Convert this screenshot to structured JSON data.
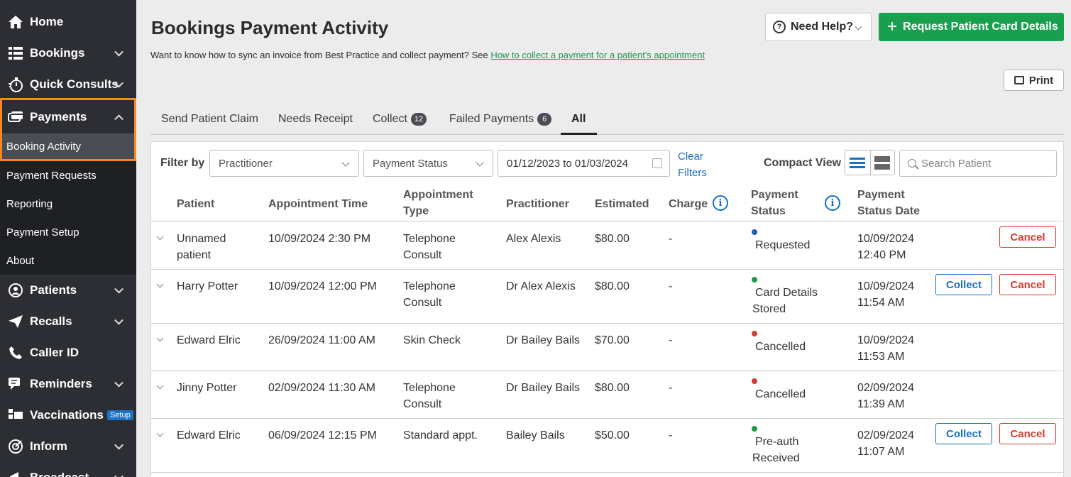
{
  "sidebar": {
    "items_top": [
      {
        "label": "Home",
        "icon": "home-icon"
      },
      {
        "label": "Bookings",
        "icon": "bookings-icon"
      },
      {
        "label": "Quick Consults",
        "icon": "stopwatch-icon"
      }
    ],
    "payments": {
      "label": "Payments",
      "icon": "payments-icon",
      "active_sub": "Booking Activity"
    },
    "sub_items": [
      "Payment Requests",
      "Reporting",
      "Payment Setup",
      "About"
    ],
    "items_bottom": [
      {
        "label": "Patients",
        "icon": "patients-icon"
      },
      {
        "label": "Recalls",
        "icon": "send-icon"
      },
      {
        "label": "Caller ID",
        "icon": "phone-icon"
      },
      {
        "label": "Reminders",
        "icon": "chat-icon"
      },
      {
        "label": "Vaccinations",
        "icon": "vaccination-icon",
        "badge": "Setup"
      },
      {
        "label": "Inform",
        "icon": "inform-icon"
      },
      {
        "label": "Broadcast",
        "icon": "broadcast-icon"
      }
    ]
  },
  "header": {
    "title": "Bookings Payment Activity",
    "intro_text": "Want to know how to sync an invoice from Best Practice and collect payment? See ",
    "intro_link": "How to collect a payment for a patient's appointment",
    "help_label": "Need Help?",
    "request_label": "Request Patient Card Details",
    "print_label": "Print"
  },
  "tabs": [
    {
      "label": "Send Patient Claim",
      "count": null
    },
    {
      "label": "Needs Receipt",
      "count": null
    },
    {
      "label": "Collect",
      "count": "12"
    },
    {
      "label": "Failed Payments",
      "count": "6"
    },
    {
      "label": "All",
      "count": null
    }
  ],
  "filters": {
    "label": "Filter by",
    "practitioner": "Practitioner",
    "payment_status": "Payment Status",
    "date_range": "01/12/2023 to 01/03/2024",
    "clear_line1": "Clear",
    "clear_line2": "Filters",
    "compact_view": "Compact View",
    "search_placeholder": "Search Patient"
  },
  "table": {
    "headers": {
      "patient": "Patient",
      "appt_time": "Appointment Time",
      "appt_type_1": "Appointment",
      "appt_type_2": "Type",
      "practitioner": "Practitioner",
      "estimated": "Estimated",
      "charge": "Charge",
      "status_1": "Payment",
      "status_2": "Status",
      "status_date_1": "Payment",
      "status_date_2": "Status Date"
    },
    "rows": [
      {
        "patient": [
          "Unnamed",
          "patient"
        ],
        "time": "10/09/2024 2:30 PM",
        "type": [
          "Telephone",
          "Consult"
        ],
        "practitioner": "Alex Alexis",
        "estimated": "$80.00",
        "charge": "-",
        "status": [
          "Requested"
        ],
        "status_color": "#1a5fc0",
        "date": [
          "10/09/2024",
          "12:40 PM"
        ],
        "collect": false,
        "cancel": true
      },
      {
        "patient": [
          "Harry Potter"
        ],
        "time": "10/09/2024 12:00 PM",
        "type": [
          "Telephone",
          "Consult"
        ],
        "practitioner": "Dr Alex Alexis",
        "estimated": "$80.00",
        "charge": "-",
        "status": [
          "Card Details",
          "Stored"
        ],
        "status_color": "#1a9a4c",
        "date": [
          "10/09/2024",
          "11:54 AM"
        ],
        "collect": true,
        "cancel": true
      },
      {
        "patient": [
          "Edward Elric"
        ],
        "time": "26/09/2024 11:00 AM",
        "type": [
          "Skin Check"
        ],
        "practitioner": "Dr Bailey Bails",
        "estimated": "$70.00",
        "charge": "-",
        "status": [
          "Cancelled"
        ],
        "status_color": "#d63b2f",
        "date": [
          "10/09/2024",
          "11:53 AM"
        ],
        "collect": false,
        "cancel": false
      },
      {
        "patient": [
          "Jinny Potter"
        ],
        "time": "02/09/2024 11:30 AM",
        "type": [
          "Telephone",
          "Consult"
        ],
        "practitioner": "Dr Bailey Bails",
        "estimated": "$80.00",
        "charge": "-",
        "status": [
          "Cancelled"
        ],
        "status_color": "#d63b2f",
        "date": [
          "02/09/2024",
          "11:39 AM"
        ],
        "collect": false,
        "cancel": false
      },
      {
        "patient": [
          "Edward Elric"
        ],
        "time": "06/09/2024 12:15 PM",
        "type": [
          "Standard appt."
        ],
        "practitioner": "Bailey Bails",
        "estimated": "$50.00",
        "charge": "-",
        "status": [
          "Pre-auth",
          "Received"
        ],
        "status_color": "#1a9a4c",
        "date": [
          "02/09/2024",
          "11:07 AM"
        ],
        "collect": true,
        "cancel": true
      }
    ],
    "collect_label": "Collect",
    "cancel_label": "Cancel"
  },
  "colors": {
    "sidebar_bg": "#2c2e33",
    "accent_green": "#19a04f",
    "highlight_orange": "#f28a21",
    "link_blue": "#1a6fc0",
    "cancel_red": "#d63b2f"
  }
}
